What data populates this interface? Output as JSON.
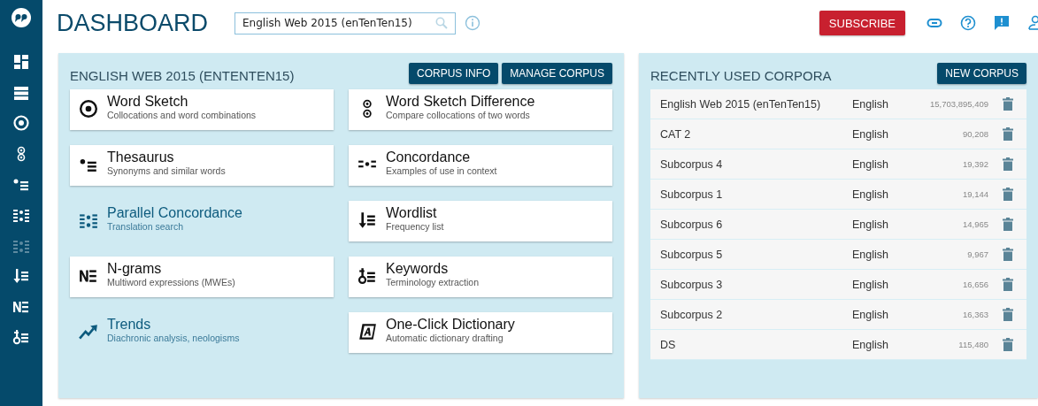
{
  "header": {
    "title": "DASHBOARD",
    "search": {
      "value": "English Web 2015 (enTenTen15)"
    },
    "subscribe": "SUBSCRIBE"
  },
  "sidebar": {
    "items": [
      {
        "kind": "dashboard",
        "disabled": false
      },
      {
        "kind": "corpora",
        "disabled": false
      },
      {
        "kind": "wordsketch",
        "disabled": false
      },
      {
        "kind": "wsdiff",
        "disabled": false
      },
      {
        "kind": "thesaurus",
        "disabled": false
      },
      {
        "kind": "concordance",
        "disabled": false
      },
      {
        "kind": "parallel",
        "disabled": true
      },
      {
        "kind": "wordlist",
        "disabled": false
      },
      {
        "kind": "ngrams",
        "disabled": false
      },
      {
        "kind": "keywords",
        "disabled": false
      }
    ]
  },
  "corpus_panel": {
    "title": "ENGLISH WEB 2015 (ENTENTEN15)",
    "buttons": [
      "CORPUS INFO",
      "MANAGE CORPUS"
    ],
    "tools": [
      {
        "kind": "wordsketch",
        "name": "Word Sketch",
        "description": "Collocations and word combinations",
        "available": true
      },
      {
        "kind": "wsdiff",
        "name": "Word Sketch Difference",
        "description": "Compare collocations of two words",
        "available": true
      },
      {
        "kind": "thesaurus",
        "name": "Thesaurus",
        "description": "Synonyms and similar words",
        "available": true
      },
      {
        "kind": "concordance",
        "name": "Concordance",
        "description": "Examples of use in context",
        "available": true
      },
      {
        "kind": "parallel",
        "name": "Parallel Concordance",
        "description": "Translation search",
        "available": false
      },
      {
        "kind": "wordlist",
        "name": "Wordlist",
        "description": "Frequency list",
        "available": true
      },
      {
        "kind": "ngrams",
        "name": "N-grams",
        "description": "Multiword expressions (MWEs)",
        "available": true
      },
      {
        "kind": "keywords",
        "name": "Keywords",
        "description": "Terminology extraction",
        "available": true
      },
      {
        "kind": "trends",
        "name": "Trends",
        "description": "Diachronic analysis, neologisms",
        "available": false
      },
      {
        "kind": "dictionary",
        "name": "One-Click Dictionary",
        "description": "Automatic dictionary drafting",
        "available": true
      }
    ]
  },
  "recent_panel": {
    "title": "RECENTLY USED CORPORA",
    "button": "NEW CORPUS",
    "rows": [
      {
        "name": "English Web 2015 (enTenTen15)",
        "language": "English",
        "size": "15,703,895,409"
      },
      {
        "name": "CAT 2",
        "language": "English",
        "size": "90,208"
      },
      {
        "name": "Subcorpus 4",
        "language": "English",
        "size": "19,392"
      },
      {
        "name": "Subcorpus 1",
        "language": "English",
        "size": "19,144"
      },
      {
        "name": "Subcorpus 6",
        "language": "English",
        "size": "14,965"
      },
      {
        "name": "Subcorpus 5",
        "language": "English",
        "size": "9,967"
      },
      {
        "name": "Subcorpus 3",
        "language": "English",
        "size": "16,656"
      },
      {
        "name": "Subcorpus 2",
        "language": "English",
        "size": "16,363"
      },
      {
        "name": "DS",
        "language": "English",
        "size": "115,480"
      }
    ]
  }
}
